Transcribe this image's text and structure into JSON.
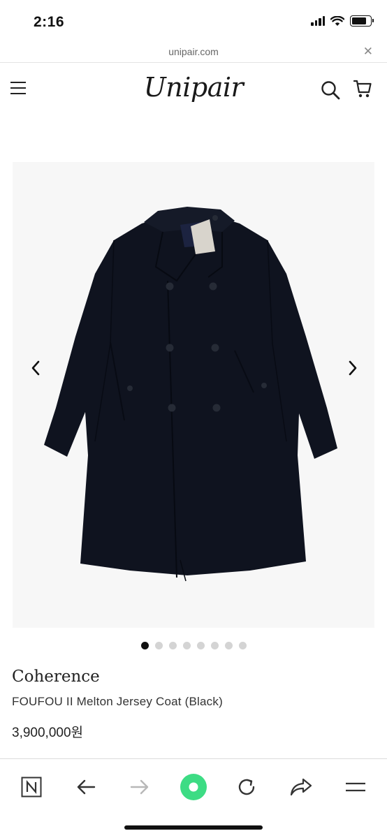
{
  "status_bar": {
    "time": "2:16",
    "icons": [
      "cellular-signal-icon",
      "wifi-icon",
      "battery-icon"
    ]
  },
  "browser": {
    "url": "unipair.com",
    "close_icon": "close-icon"
  },
  "header": {
    "logo": "Unipair",
    "menu_icon": "hamburger-menu-icon",
    "search_icon": "search-icon",
    "cart_icon": "cart-icon"
  },
  "gallery": {
    "image_subject": "black coat",
    "prev_icon": "chevron-left-icon",
    "next_icon": "chevron-right-icon",
    "slide_count": 8,
    "active_slide": 1
  },
  "product": {
    "brand": "Coherence",
    "name": "FOUFOU II Melton Jersey Coat (Black)",
    "price": "3,900,000원"
  },
  "toolbar": {
    "items": [
      "naver-n-icon",
      "back-arrow-icon",
      "forward-arrow-icon",
      "green-circle-icon",
      "reload-icon",
      "share-icon",
      "menu-lines-icon"
    ]
  },
  "colors": {
    "coat": "#0f131f",
    "image_bg": "#f7f7f7",
    "green_button": "#3ddc84",
    "dot_active": "#111111",
    "dot_inactive": "#d4d4d4"
  }
}
